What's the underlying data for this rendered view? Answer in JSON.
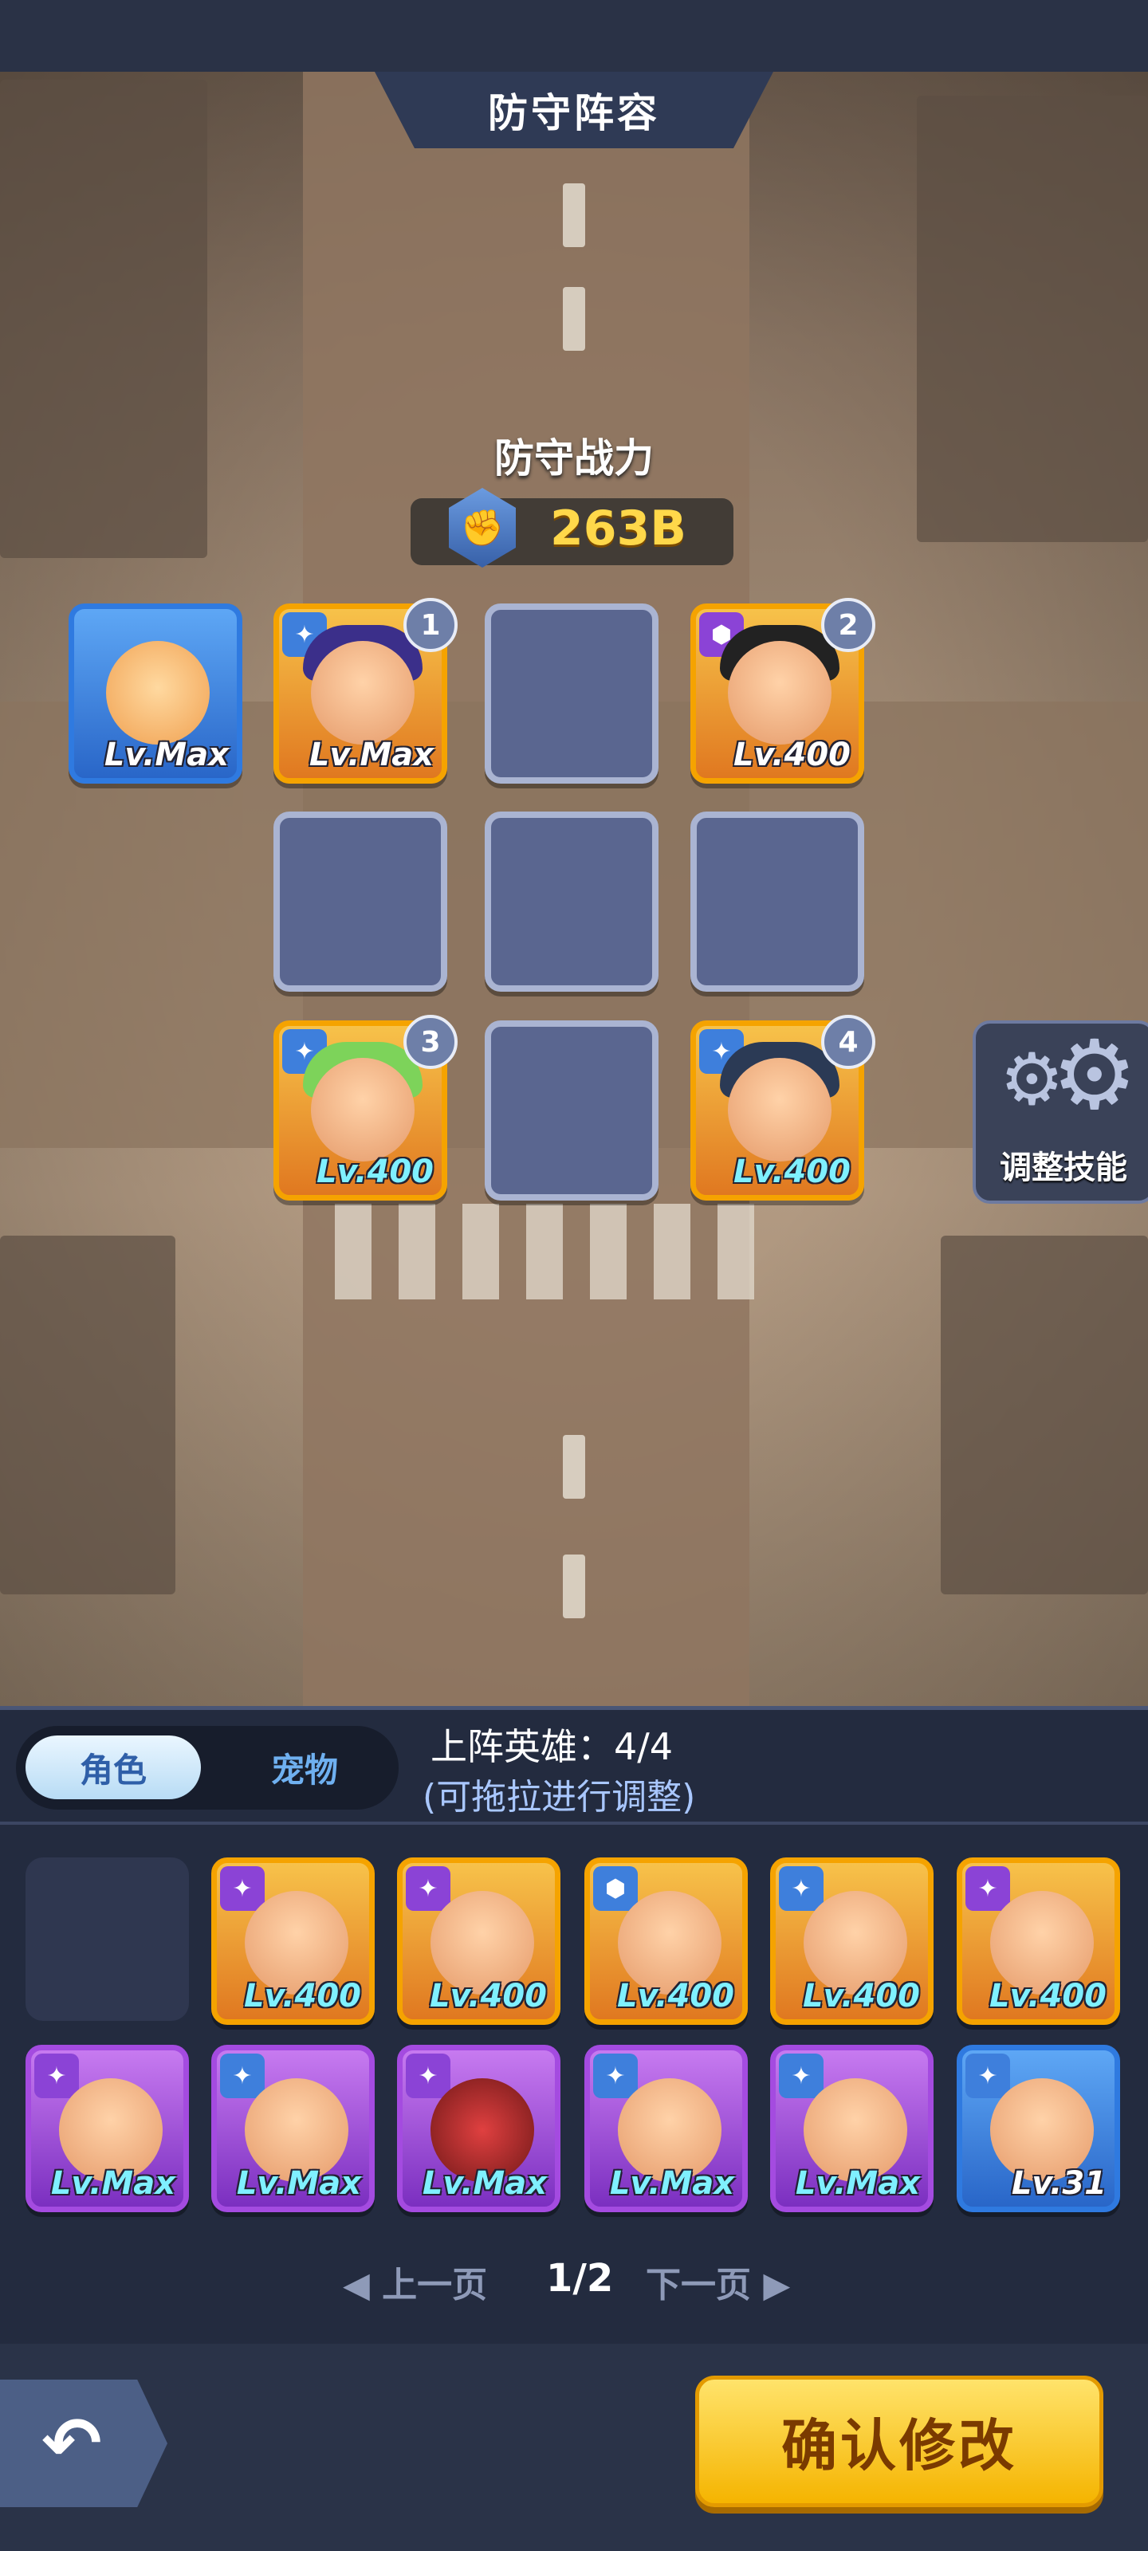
{
  "header": {
    "title": "防守阵容"
  },
  "defense": {
    "power_label": "防守战力",
    "power_value": "263B"
  },
  "formation": [
    {
      "level": "Lv.Max",
      "badge": null,
      "type": "pet"
    },
    {
      "level": "Lv.Max",
      "badge": "1"
    },
    {
      "level": null
    },
    {
      "level": "Lv.400",
      "badge": "2"
    },
    {
      "level": null
    },
    {
      "level": null
    },
    {
      "level": null
    },
    {
      "level": "Lv.400",
      "badge": "3"
    },
    {
      "level": null
    },
    {
      "level": "Lv.400",
      "badge": "4"
    }
  ],
  "skill_button": {
    "label": "调整技能"
  },
  "tabs": {
    "role": "角色",
    "pet": "宠物"
  },
  "roster_info": {
    "count": "上阵英雄：4/4",
    "hint": "(可拖拉进行调整)"
  },
  "roster": {
    "row1": [
      {
        "level": "Lv.400"
      },
      {
        "level": "Lv.400"
      },
      {
        "level": "Lv.400"
      },
      {
        "level": "Lv.400"
      },
      {
        "level": "Lv.400"
      }
    ],
    "row2": [
      {
        "level": "Lv.Max"
      },
      {
        "level": "Lv.Max"
      },
      {
        "level": "Lv.Max"
      },
      {
        "level": "Lv.Max"
      },
      {
        "level": "Lv.Max"
      },
      {
        "level": "Lv.31"
      }
    ]
  },
  "pager": {
    "prev": "◀ 上一页",
    "page": "1/2",
    "next": "下一页 ▶"
  },
  "confirm": {
    "label": "确认修改"
  },
  "back": {
    "icon": "back-arrow-icon"
  }
}
